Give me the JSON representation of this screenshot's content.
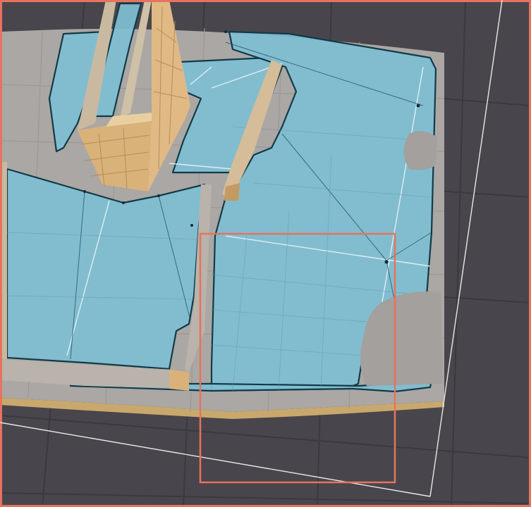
{
  "viewport": {
    "background_color": "#48464c",
    "grid_color": "#3b3a3f",
    "ground_top_color": "#aaa7a4",
    "ground_edge_color": "#c9a86d",
    "navmesh_color": "#7fbfd2",
    "navmesh_edge_color": "#123a48",
    "building_color": "#d8b07a",
    "selection_color": "#e6735f",
    "bounds_line_color": "#e8e8e8"
  }
}
